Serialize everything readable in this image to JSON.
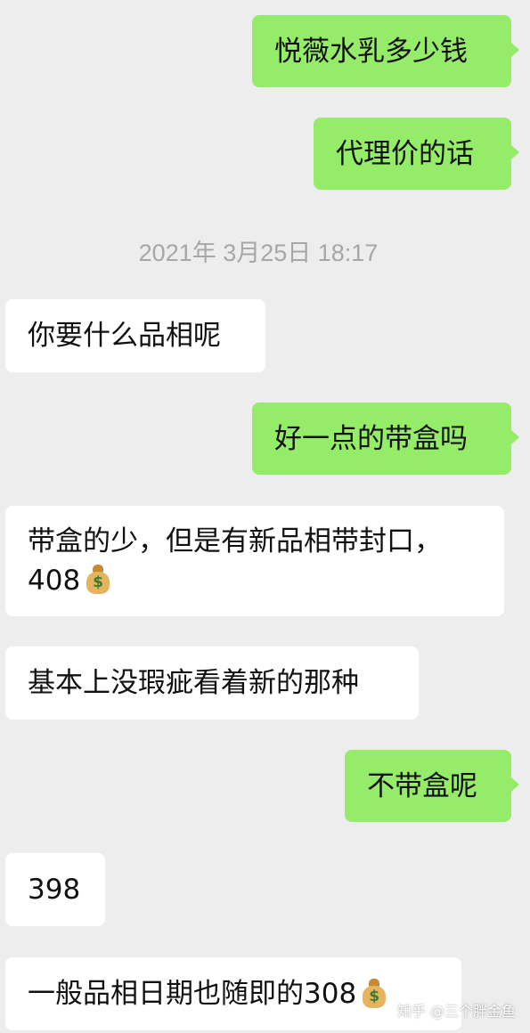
{
  "chat": {
    "messages": [
      {
        "sender": "me",
        "text": "悦薇水乳多少钱"
      },
      {
        "sender": "me",
        "text": "代理价的话"
      },
      {
        "sender": "other",
        "text": "你要什么品相呢"
      },
      {
        "sender": "me",
        "text": "好一点的带盒吗"
      },
      {
        "sender": "other",
        "text": "带盒的少，但是有新品相带封口，",
        "line2": "408",
        "icon": "moneybag-icon"
      },
      {
        "sender": "other",
        "text": "基本上没瑕疵看着新的那种"
      },
      {
        "sender": "me",
        "text": "不带盒呢"
      },
      {
        "sender": "other",
        "text": "398"
      },
      {
        "sender": "other",
        "text": "一般品相日期也随即的308",
        "icon": "moneybag-icon"
      }
    ],
    "timestamp": "2021年 3月25日 18:17"
  },
  "icons": {
    "moneybag_glyph": "$"
  },
  "watermark": "知乎 @三个胖金鱼",
  "colors": {
    "background": "#ededed",
    "sent_bubble": "#95ec69",
    "received_bubble": "#ffffff",
    "timestamp_text": "#a7a7a7"
  }
}
